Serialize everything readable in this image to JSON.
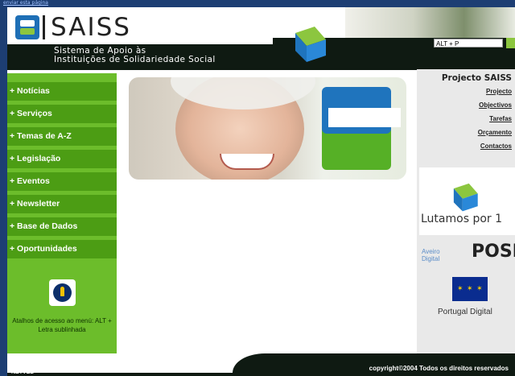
{
  "browser": {
    "corner_link": "enviar esta página"
  },
  "header": {
    "logo_text": "SAISS",
    "subtitle_line1": "Sistema de Apoio às",
    "subtitle_line2": "Instituições de Solidariedade Social",
    "shortcut_value": "ALT + P"
  },
  "nav": {
    "items": [
      {
        "label": "+ Notícias"
      },
      {
        "label": "+ Serviços"
      },
      {
        "label": "+ Temas de A-Z"
      },
      {
        "label": "+ Legislação"
      },
      {
        "label": "+ Eventos"
      },
      {
        "label": "+ Newsletter"
      },
      {
        "label": "+ Base de Dados"
      },
      {
        "label": "+ Oportunidades"
      }
    ],
    "access_text": "Atalhos de acesso ao menú: ALT + Letra sublinhada"
  },
  "right": {
    "title": "Projecto SAISS",
    "links": [
      {
        "label": "Projecto"
      },
      {
        "label": "Objectivos"
      },
      {
        "label": "Tarefas"
      },
      {
        "label": "Orçamento"
      },
      {
        "label": "Contactos"
      }
    ],
    "lutamos_text": "Lutamos por 1",
    "partners": {
      "aveiro": "Aveiro Digital",
      "posi": "POSI",
      "portugal": "Portugal Digital"
    }
  },
  "footer": {
    "copyright": "copyright©2004 Todos os direitos reservados",
    "netvel": "NETVEL"
  },
  "colors": {
    "nav_green": "#6cbd2b",
    "nav_item": "#4c9d14",
    "dark": "#0f1a12",
    "blue": "#1f74bd"
  }
}
